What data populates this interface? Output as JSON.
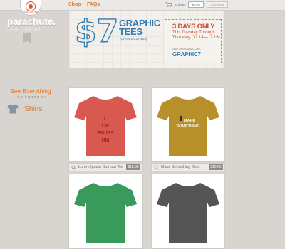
{
  "header": {
    "logo_badge_text": "PARACHUTE",
    "nav": [
      "Shop",
      "FAQs"
    ],
    "cart": {
      "items_text": "0 items",
      "total": "$0.00",
      "checkout_label": "Checkout"
    }
  },
  "sidebar": {
    "brand_name": "parachute.",
    "tagline": "ts and other stuff",
    "see_everything": "See Everything",
    "filter_label": "OR FILTER BY",
    "category": "Shirts"
  },
  "promo": {
    "price": "$7",
    "title": "GRAPHIC TEES",
    "original": "(ORIGINALLY $18)",
    "days": "3 DAYS ONLY",
    "dates": "This Tuesday Through Thursday (12.14—12.16)",
    "code_label": "Use Discount Code:",
    "code": "GRAPHIC7",
    "accent_color": "#2f7db5",
    "urgent_color": "#c94a2a"
  },
  "products": [
    {
      "name": "Lorem Ipsum Burnout Tee",
      "price": "$18.00",
      "shirt_color": "#d9584f",
      "print_text": "LOR EM IPS UM",
      "print_color": "#9a2a28"
    },
    {
      "name": "Make Something Gold",
      "price": "$18.00",
      "shirt_color": "#b8902a",
      "print_text": "MAKE SOMETHING",
      "print_color": "#f5f1e6"
    },
    {
      "name": "",
      "price": "",
      "shirt_color": "#3a9a5c",
      "print_text": "",
      "print_color": ""
    },
    {
      "name": "",
      "price": "",
      "shirt_color": "#555555",
      "print_text": "",
      "print_color": ""
    }
  ],
  "colors": {
    "orange_link": "#e27a2a",
    "background": "#d8d4cf"
  }
}
